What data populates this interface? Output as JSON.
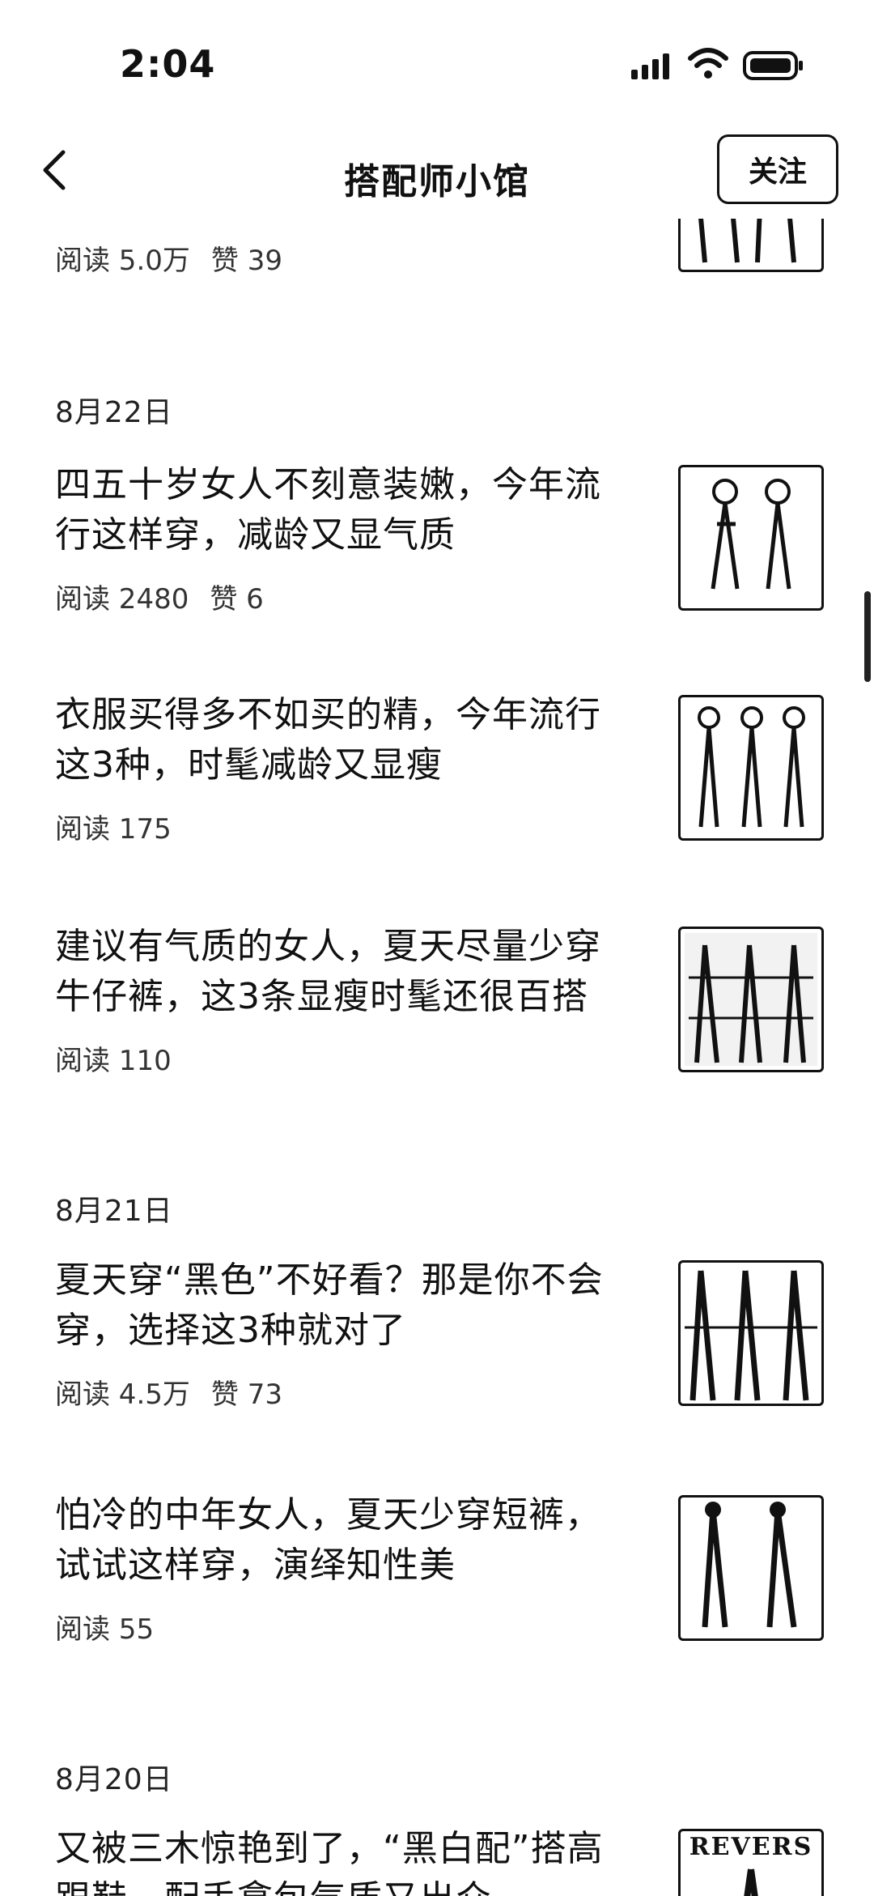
{
  "status_bar": {
    "time": "2:04"
  },
  "nav": {
    "title": "搭配师小馆",
    "follow_label": "关注"
  },
  "top_partial": {
    "reads": "阅读 5.0万",
    "likes": "赞 39"
  },
  "groups": [
    {
      "date": "8月22日",
      "articles": [
        {
          "title_line1": "四五十岁女人不刻意装嫩，今年流",
          "title_line2": "行这样穿，减龄又显气质",
          "reads": "阅读 2480",
          "likes": "赞 6"
        },
        {
          "title_line1": "衣服买得多不如买的精，今年流行",
          "title_line2": "这3种，时髦减龄又显瘦",
          "reads": "阅读 175",
          "likes": ""
        },
        {
          "title_line1": "建议有气质的女人，夏天尽量少穿",
          "title_line2": "牛仔裤，这3条显瘦时髦还很百搭",
          "reads": "阅读 110",
          "likes": ""
        }
      ]
    },
    {
      "date": "8月21日",
      "articles": [
        {
          "title_line1": "夏天穿“黑色”不好看？那是你不会",
          "title_line2": "穿，选择这3种就对了",
          "reads": "阅读 4.5万",
          "likes": "赞 73"
        },
        {
          "title_line1": "怕冷的中年女人，夏天少穿短裤，",
          "title_line2": "试试这样穿，演绎知性美",
          "reads": "阅读 55",
          "likes": ""
        }
      ]
    },
    {
      "date": "8月20日",
      "articles": [
        {
          "title_line1": "又被三木惊艳到了，“黑白配”搭高",
          "title_line2": "跟鞋，配手拿包气质又出众",
          "reads": "",
          "likes": ""
        }
      ]
    }
  ],
  "last_thumb_text": "REVERS",
  "icons": {
    "back": "chevron-left-icon",
    "signal": "signal-icon",
    "wifi": "wifi-icon",
    "battery": "battery-icon"
  }
}
